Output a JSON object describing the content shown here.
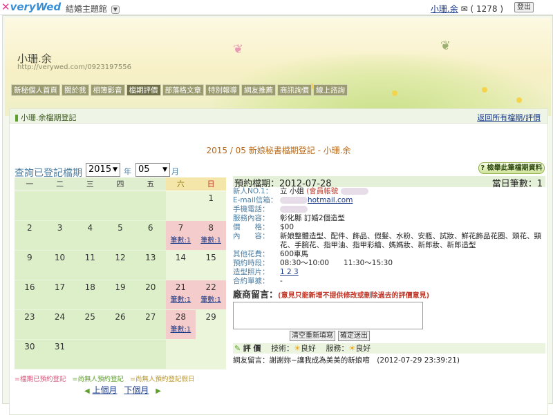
{
  "topbar": {
    "logo": "veryWed",
    "site_menu": "結婚主題館",
    "user_name": "小珊.余",
    "mail_count": "( 1278 )",
    "logout": "登出"
  },
  "banner": {
    "owner_name": "小珊.余",
    "owner_url": "http://verywed.com/0923197556"
  },
  "nav": [
    "新秘個人首頁",
    "關於我",
    "相簿影音",
    "檔期評價",
    "部落格文章",
    "特別報導",
    "網友推薦",
    "商訊詢價",
    "線上諮詢"
  ],
  "panel": {
    "title": "小珊.余檔期登記",
    "back_link": "返回所有檔期/評價",
    "month_title": "2015 / 05 新娘秘書檔期登記 - 小珊.余",
    "query_label": "查詢已登記檔期",
    "year_value": "2015",
    "year_unit": "年",
    "month_value": "05",
    "month_unit": "月",
    "check_button": "檢舉此筆檔期資料"
  },
  "calendar": {
    "weekdays": [
      "一",
      "二",
      "三",
      "四",
      "五",
      "六",
      "日"
    ],
    "count_label": "筆數:1",
    "weeks": [
      [
        "",
        "",
        "",
        "",
        "",
        "",
        "1"
      ],
      [
        "2",
        "3",
        "4",
        "5",
        "6",
        "7",
        "8"
      ],
      [
        "9",
        "10",
        "11",
        "12",
        "13",
        "14",
        "15"
      ],
      [
        "16",
        "17",
        "18",
        "19",
        "20",
        "21",
        "22"
      ],
      [
        "23",
        "24",
        "25",
        "26",
        "27",
        "28",
        "29"
      ],
      [
        "30",
        "31",
        "",
        "",
        "",
        "",
        ""
      ]
    ],
    "booked": [
      "7",
      "8",
      "21",
      "22",
      "28"
    ]
  },
  "legend": {
    "booked": "=檔期已預約登記",
    "open": "=尚無人預約登記",
    "open_holiday": "=尚無人預約登記假日"
  },
  "pager": {
    "prev": "上個月",
    "next": "下個月"
  },
  "detail": {
    "date_label": "預約檔期：2012-07-28",
    "day_count": "當日筆數：1",
    "rows": [
      {
        "k": "新人NO.1：",
        "v": "立 小姐",
        "extra": "(會員帳號"
      },
      {
        "k": "E-mail信箱：",
        "v": "hotmail.com"
      },
      {
        "k": "手機電話：",
        "v": ""
      },
      {
        "k": "服務內容：",
        "v": "彰化縣 訂婚2個造型"
      },
      {
        "k": "價　　格：",
        "v": "$00"
      },
      {
        "k": "內　　容：",
        "v": "新娘整體造型、配件、飾品、假髮、水粉、安瓶、試妝、鮮花飾品花圈、頭花、頸花、手腕花、指甲油、指甲彩繪、媽媽妝、新郎妝、新郎造型"
      },
      {
        "k": "其他花費：",
        "v": "600車馬"
      },
      {
        "k": "預約時段：",
        "v": "08:30～10:00　　11:30～15:30"
      },
      {
        "k": "造型照片：",
        "v": "1 2 3"
      },
      {
        "k": "合約單據：",
        "v": "-"
      }
    ],
    "msg_label": "廠商留言：",
    "msg_warn": "(意見只能新增不提供修改或刪除過去的評價意見)",
    "clear_button": "清空重新填寫",
    "submit_button": "確定送出",
    "rating_title": "評 價",
    "skill_label": "技術：",
    "skill_value": "良好",
    "service_label": "服務：",
    "service_value": "良好",
    "review": "網友留言：謝謝妳~讓我成為美美的新娘唷　(2012-07-29 23:39:21)"
  }
}
